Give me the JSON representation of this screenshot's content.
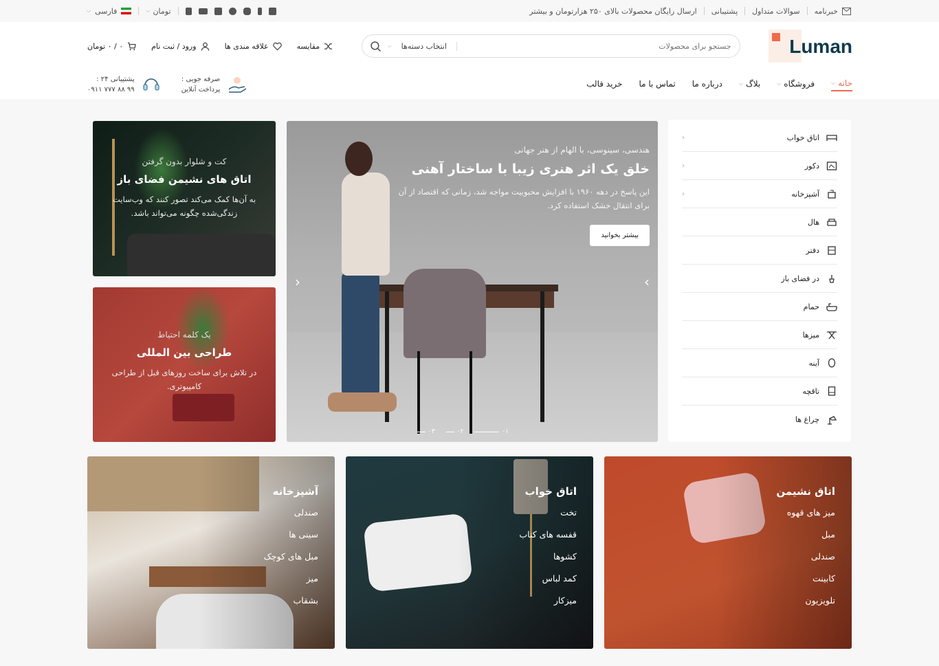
{
  "topbar": {
    "newsletter": "خبرنامه",
    "faq": "سوالات متداول",
    "support": "پشتیبانی",
    "shipping": "ارسال رایگان محصولات بالای ۲۵۰ هزارتومان و بیشتر",
    "currency": "تومان",
    "language": "فارسی"
  },
  "header": {
    "logo": "Luman",
    "search_placeholder": "جستجو برای محصولات",
    "category_select": "انتخاب دسته‌ها",
    "compare": "مقایسه",
    "wishlist": "علاقه مندی ها",
    "login": "ورود / ثبت نام",
    "cart": "۰ / ۰ تومان"
  },
  "nav": {
    "items": [
      {
        "label": "خانه",
        "has_dropdown": true,
        "active": true
      },
      {
        "label": "فروشگاه",
        "has_dropdown": true
      },
      {
        "label": "بلاگ",
        "has_dropdown": true
      },
      {
        "label": "درباره ما"
      },
      {
        "label": "تماس با ما"
      },
      {
        "label": "خرید قالب"
      }
    ],
    "payment_title": "صرفه جویی :",
    "payment_sub": "پرداخت آنلاین",
    "support_title": "پشتیبانی ۲۴ :",
    "support_phone": "۰۹۱۱ ۷۷۷ ۸۸ ۹۹"
  },
  "categories": [
    {
      "label": "اتاق خواب",
      "icon": "bed-icon",
      "sub": true
    },
    {
      "label": "دکور",
      "icon": "frame-icon",
      "sub": true
    },
    {
      "label": "آشپزخانه",
      "icon": "cooker-icon",
      "sub": true
    },
    {
      "label": "هال",
      "icon": "sofa-icon"
    },
    {
      "label": "دفتر",
      "icon": "desk-icon"
    },
    {
      "label": "در فضای باز",
      "icon": "plant-icon"
    },
    {
      "label": "حمام",
      "icon": "bathtub-icon"
    },
    {
      "label": "میزها",
      "icon": "table-icon"
    },
    {
      "label": "آینه",
      "icon": "mirror-icon"
    },
    {
      "label": "تاقچه",
      "icon": "shelf-icon"
    },
    {
      "label": "چراغ ها",
      "icon": "lamp-icon"
    }
  ],
  "slider": {
    "subtitle": "هندسی، سینوسی، با الهام از هنر جهانی",
    "title": "خلق یک اثر هنری زیبا با ساختار آهنی",
    "text": "این پاسخ در دهه ۱۹۶۰ با افزایش محبوبیت مواجه شد، زمانی که اقتصاد از آن برای انتقال خشک استفاده کرد.",
    "button": "بیشتر بخوانید",
    "dots": [
      "۰۱",
      "۰۲",
      "۰۳"
    ]
  },
  "side_banners": [
    {
      "sub": "کت و شلوار بدون گرفتن",
      "title": "اتاق های نشیمن فضای باز",
      "text": "به آن‌ها کمک می‌کند تصور کنند که وب‌سایت زندگی‌شده چگونه می‌تواند باشد."
    },
    {
      "sub": "یک کلمه احتیاط",
      "title": "طراحی بین المللی",
      "text": "در تلاش برای ساخت روزهای قبل از طراحی کامپیوتری."
    }
  ],
  "tiles": [
    {
      "title": "اتاق نشیمن",
      "items": [
        "میز های قهوه",
        "مبل",
        "صندلی",
        "کابینت",
        "تلویزیون"
      ]
    },
    {
      "title": "اتاق خواب",
      "items": [
        "تخت",
        "قفسه های کتاب",
        "کشوها",
        "کمد لباس",
        "میزکار"
      ]
    },
    {
      "title": "آشپزخانه",
      "items": [
        "صندلی",
        "سینی ها",
        "مبل های کوچک",
        "میز",
        "بشقاب"
      ]
    }
  ],
  "colors": {
    "accent": "#ef6b4d",
    "logo": "#103b4b"
  }
}
